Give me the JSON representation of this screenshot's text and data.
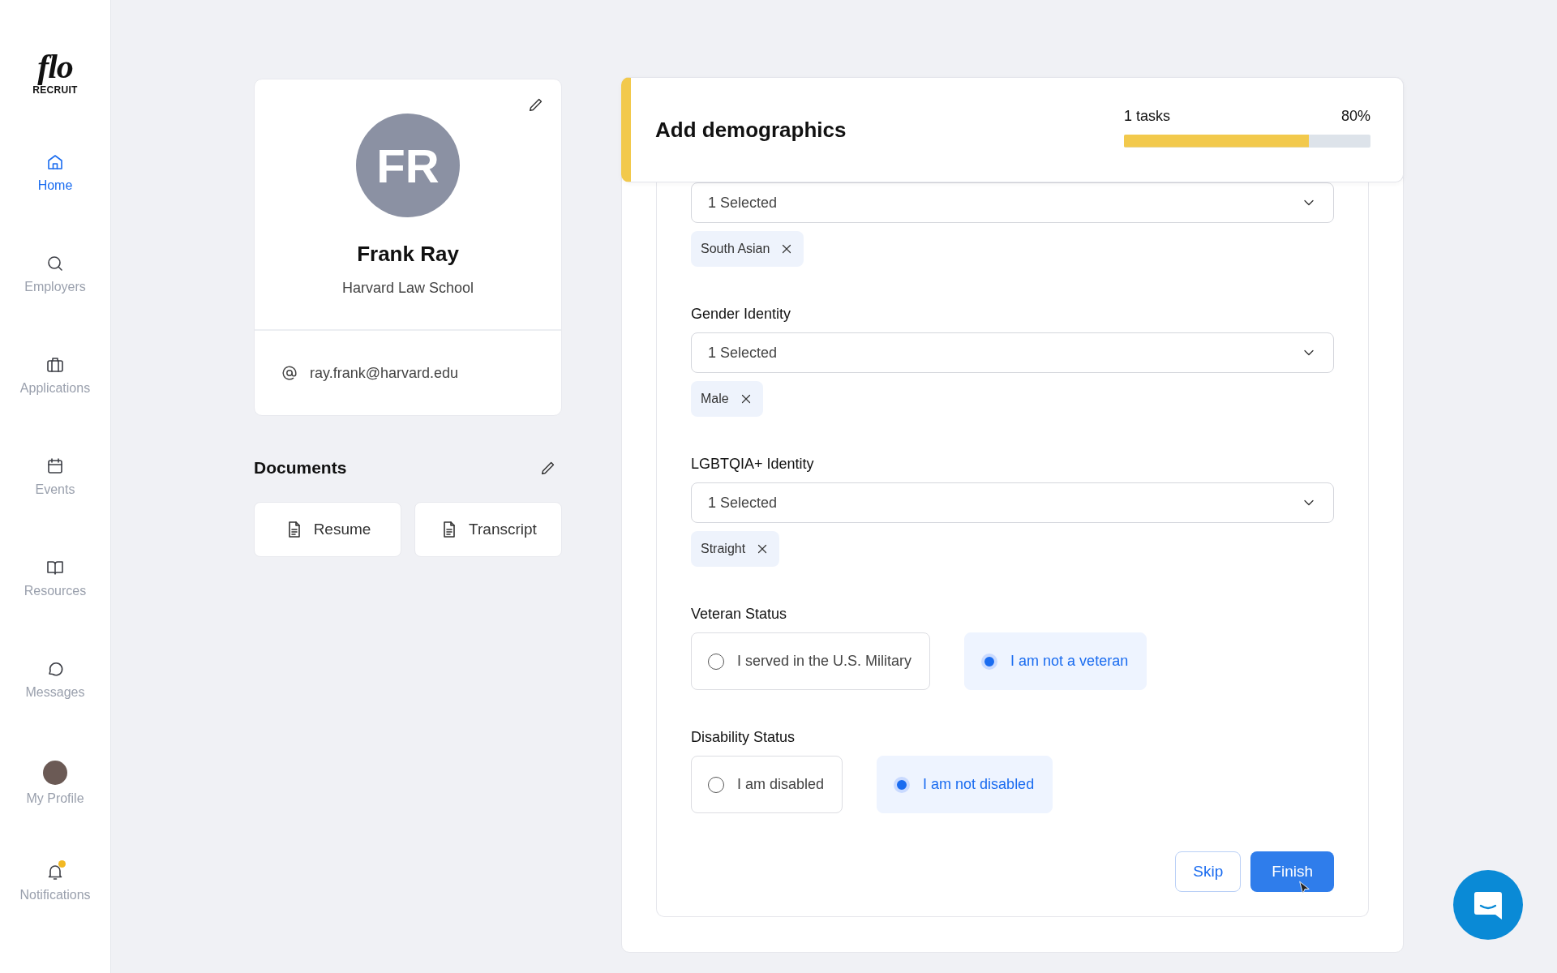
{
  "sidebar": {
    "logo": {
      "script": "flo",
      "wordmark": "RECRUIT"
    },
    "items": [
      {
        "label": "Home",
        "kind": "home",
        "selected": true
      },
      {
        "label": "Employers",
        "kind": "search",
        "selected": false
      },
      {
        "label": "Applications",
        "kind": "briefcase",
        "selected": false
      },
      {
        "label": "Events",
        "kind": "calendar",
        "selected": false
      },
      {
        "label": "Resources",
        "kind": "book",
        "selected": false
      },
      {
        "label": "Messages",
        "kind": "chat",
        "selected": false
      },
      {
        "label": "My Profile",
        "kind": "avatar",
        "selected": false
      },
      {
        "label": "Notifications",
        "kind": "bell",
        "selected": false,
        "unread": true
      }
    ]
  },
  "profile": {
    "initials": "FR",
    "name": "Frank Ray",
    "school": "Harvard Law School",
    "email": "ray.frank@harvard.edu"
  },
  "documents": {
    "title": "Documents",
    "items": [
      "Resume",
      "Transcript"
    ]
  },
  "task": {
    "title": "Add demographics",
    "count": "1 tasks",
    "percent": "80%",
    "level": 0.75
  },
  "form": {
    "fields": [
      {
        "kind": "multiselect",
        "value": "1 Selected",
        "tags": [
          "South Asian"
        ]
      },
      {
        "kind": "multiselect",
        "label": "Gender Identity",
        "value": "1 Selected",
        "tags": [
          "Male"
        ]
      },
      {
        "kind": "multiselect",
        "label": "LGBTQIA+ Identity",
        "value": "1 Selected",
        "tags": [
          "Straight"
        ]
      },
      {
        "kind": "radio",
        "label": "Veteran Status",
        "options": [
          {
            "label": "I served in the U.S. Military",
            "selected": false
          },
          {
            "label": "I am not a veteran",
            "selected": true
          }
        ]
      },
      {
        "kind": "radio",
        "label": "Disability Status",
        "options": [
          {
            "label": "I am disabled",
            "selected": false
          },
          {
            "label": "I am not disabled",
            "selected": true
          }
        ]
      }
    ],
    "buttons": [
      {
        "label": "Skip",
        "kind": "secondary"
      },
      {
        "label": "Finish",
        "kind": "primary"
      }
    ]
  }
}
